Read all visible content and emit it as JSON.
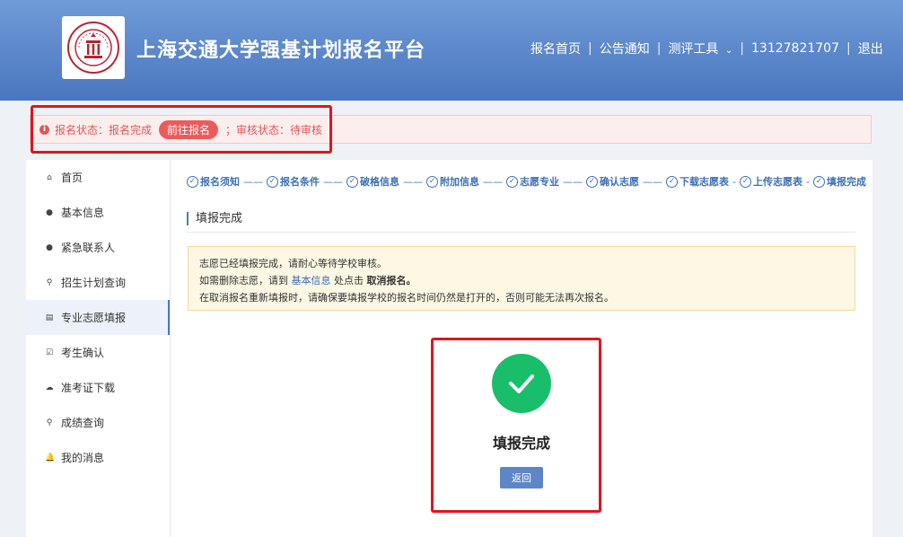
{
  "header": {
    "site_title": "上海交通大学强基计划报名平台",
    "nav": {
      "home": "报名首页",
      "notice": "公告通知",
      "tools": "测评工具",
      "phone": "13127821707",
      "logout": "退出"
    },
    "bg_color": "#5b87ca"
  },
  "status_bar": {
    "reg_status": "报名状态：报名完成",
    "goto_button": "前往报名",
    "review_status": "；审核状态：待审核"
  },
  "sidebar": {
    "items": [
      {
        "label": "首页",
        "icon": "home-icon"
      },
      {
        "label": "基本信息",
        "icon": "user-icon"
      },
      {
        "label": "紧急联系人",
        "icon": "user-icon"
      },
      {
        "label": "招生计划查询",
        "icon": "search-icon"
      },
      {
        "label": "专业志愿填报",
        "icon": "form-icon",
        "active": true
      },
      {
        "label": "考生确认",
        "icon": "checkbox-icon"
      },
      {
        "label": "准考证下载",
        "icon": "cloud-download-icon"
      },
      {
        "label": "成绩查询",
        "icon": "search-icon"
      },
      {
        "label": "我的消息",
        "icon": "bell-icon"
      }
    ]
  },
  "steps": [
    {
      "label": "报名须知",
      "sep": "——"
    },
    {
      "label": "报名条件",
      "sep": "——"
    },
    {
      "label": "破格信息",
      "sep": "——"
    },
    {
      "label": "附加信息",
      "sep": "——"
    },
    {
      "label": "志愿专业",
      "sep": "——"
    },
    {
      "label": "确认志愿",
      "sep": "——"
    },
    {
      "label": "下载志愿表",
      "sep": "-"
    },
    {
      "label": "上传志愿表",
      "sep": "-"
    },
    {
      "label": "填报完成",
      "sep": ""
    }
  ],
  "main": {
    "section_title": "填报完成",
    "notice": {
      "line1": "志愿已经填报完成，请耐心等待学校审核。",
      "line2_pre": "如需删除志愿，请到",
      "line2_link": "基本信息",
      "line2_mid": "处点击",
      "line2_bold": "取消报名。",
      "line3": "在取消报名重新填报时，请确保要填报学校的报名时间仍然是打开的，否则可能无法再次报名。"
    },
    "done_text": "填报完成",
    "back_button": "返回"
  },
  "colors": {
    "accent": "#4b77c0",
    "success": "#19be6b",
    "error": "#e05656",
    "highlight_box": "#e3131b"
  }
}
